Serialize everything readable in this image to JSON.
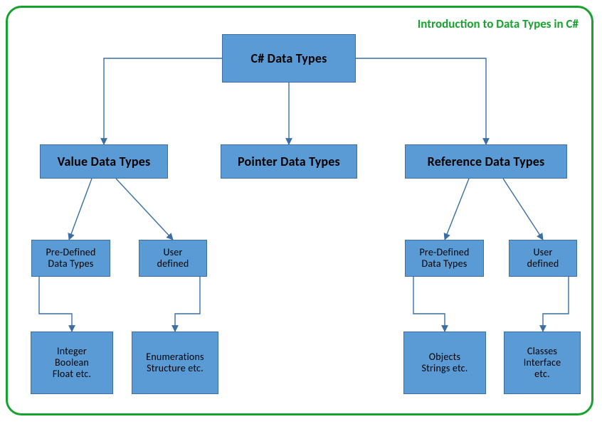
{
  "title": "Introduction to Data Types in C#",
  "colors": {
    "accent": "#17a22e",
    "node_fill": "#5b9bd5",
    "node_border": "#3a6ea5",
    "arrow": "#3a6ea5"
  },
  "chart_data": {
    "type": "tree",
    "title": "C# Data Types",
    "nodes": [
      {
        "id": "root",
        "label": "C# Data Types"
      },
      {
        "id": "value",
        "label": "Value Data Types"
      },
      {
        "id": "pointer",
        "label": "Pointer Data Types"
      },
      {
        "id": "reference",
        "label": "Reference Data Types"
      },
      {
        "id": "val_predef",
        "label": "Pre-Defined\nData Types"
      },
      {
        "id": "val_user",
        "label": "User\ndefined"
      },
      {
        "id": "ref_predef",
        "label": "Pre-Defined\nData Types"
      },
      {
        "id": "ref_user",
        "label": "User\ndefined"
      },
      {
        "id": "val_predef_ex",
        "label": "Integer\nBoolean\nFloat etc."
      },
      {
        "id": "val_user_ex",
        "label": "Enumerations\nStructure etc."
      },
      {
        "id": "ref_predef_ex",
        "label": "Objects\nStrings etc."
      },
      {
        "id": "ref_user_ex",
        "label": "Classes\nInterface\netc."
      }
    ],
    "edges": [
      [
        "root",
        "value"
      ],
      [
        "root",
        "pointer"
      ],
      [
        "root",
        "reference"
      ],
      [
        "value",
        "val_predef"
      ],
      [
        "value",
        "val_user"
      ],
      [
        "reference",
        "ref_predef"
      ],
      [
        "reference",
        "ref_user"
      ],
      [
        "val_predef",
        "val_predef_ex"
      ],
      [
        "val_user",
        "val_user_ex"
      ],
      [
        "ref_predef",
        "ref_predef_ex"
      ],
      [
        "ref_user",
        "ref_user_ex"
      ]
    ]
  }
}
